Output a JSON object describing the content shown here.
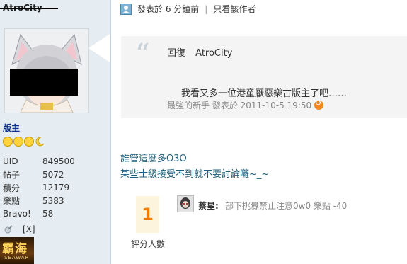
{
  "sidebar": {
    "username": "AtroCity",
    "rank": "版主",
    "stats": [
      {
        "label": "UID",
        "value": "849500"
      },
      {
        "label": "帖子",
        "value": "5072"
      },
      {
        "label": "積分",
        "value": "12179"
      },
      {
        "label": "樂點",
        "value": "5383"
      },
      {
        "label": "Bravo!",
        "value": "58"
      }
    ],
    "close_label": "[X]",
    "medal_text": "霸海",
    "medal_sub": "SEAWAR"
  },
  "post": {
    "posted_label": "發表於 6 分鐘前",
    "only_author_label": "只看該作者",
    "separator": "|",
    "quote": {
      "mark": "“",
      "reply_prefix": "回復",
      "reply_to": "AtroCity",
      "body": "我看又多一位港童厭惡樂古版主了吧……",
      "meta": "最強的新手 發表於 2011-10-5 19:50"
    },
    "message_line1": "誰管這麼多O3O",
    "message_line2": "某些士級接受不到就不要討論囖~_~"
  },
  "rating": {
    "count": "1",
    "count_label": "評分人數",
    "rater_name": "蔡星:",
    "rater_comment": "部下挑釁禁止注意0w0 樂點 -40"
  },
  "colors": {
    "sidebar_bg": "#e5edf2",
    "rank": "#0b2e8a",
    "message": "#1b5d7a",
    "rating_accent": "#f07b06"
  }
}
